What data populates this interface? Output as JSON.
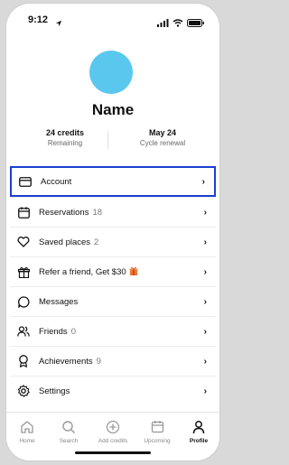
{
  "status_bar": {
    "time": "9:12"
  },
  "profile": {
    "name": "Name"
  },
  "stats": {
    "credits_value": "24 credits",
    "credits_label": "Remaining",
    "cycle_value": "May 24",
    "cycle_label": "Cycle renewal"
  },
  "menu": {
    "account": "Account",
    "reservations": "Reservations",
    "reservations_count": "18",
    "saved_places": "Saved places",
    "saved_places_count": "2",
    "refer": "Refer a friend, Get $30",
    "messages": "Messages",
    "friends": "Friends",
    "friends_count": "0",
    "achievements": "Achievements",
    "achievements_count": "9",
    "settings": "Settings"
  },
  "tabs": {
    "home": "Home",
    "search": "Search",
    "add_credits": "Add credits",
    "upcoming": "Upcoming",
    "profile": "Profile"
  },
  "colors": {
    "avatar": "#5ac8ee",
    "highlight": "#1a3fd1",
    "gift": "#e8772e"
  }
}
